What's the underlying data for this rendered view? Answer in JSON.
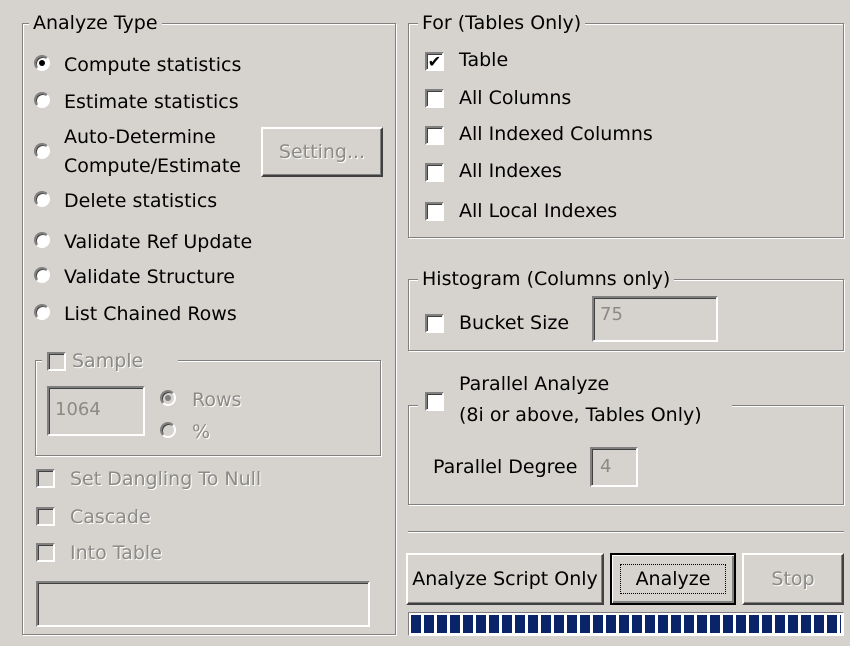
{
  "analyze_type": {
    "legend": "Analyze Type",
    "options": [
      {
        "label": "Compute statistics",
        "selected": true
      },
      {
        "label": "Estimate statistics",
        "selected": false
      },
      {
        "label_line1": "Auto-Determine",
        "label_line2": "Compute/Estimate",
        "selected": false
      },
      {
        "label": "Delete statistics",
        "selected": false
      },
      {
        "label": "Validate Ref Update",
        "selected": false
      },
      {
        "label": "Validate Structure",
        "selected": false
      },
      {
        "label": "List Chained Rows",
        "selected": false
      }
    ],
    "setting_button": "Setting...",
    "sample": {
      "label": "Sample",
      "value": "1064",
      "rows_label": "Rows",
      "percent_label": "%"
    },
    "set_dangling_label": "Set Dangling To Null",
    "cascade_label": "Cascade",
    "into_table_label": "Into Table",
    "into_table_value": ""
  },
  "for_tables": {
    "legend": "For (Tables Only)",
    "items": [
      {
        "label": "Table",
        "checked": true
      },
      {
        "label": "All Columns",
        "checked": false
      },
      {
        "label": "All Indexed Columns",
        "checked": false
      },
      {
        "label": "All Indexes",
        "checked": false
      },
      {
        "label": "All Local Indexes",
        "checked": false
      }
    ]
  },
  "histogram": {
    "legend": "Histogram (Columns only)",
    "bucket_label": "Bucket Size",
    "bucket_value": "75"
  },
  "parallel": {
    "label_line1": "Parallel Analyze",
    "label_line2": "(8i or above, Tables Only)",
    "degree_label": "Parallel Degree",
    "degree_value": "4"
  },
  "buttons": {
    "script_only": "Analyze Script Only",
    "analyze": "Analyze",
    "stop": "Stop"
  },
  "progress": {
    "fill": 1.0
  },
  "colors": {
    "background": "#d6d3ce",
    "progress": "#0a246a",
    "disabled_text": "#8c8a86"
  }
}
